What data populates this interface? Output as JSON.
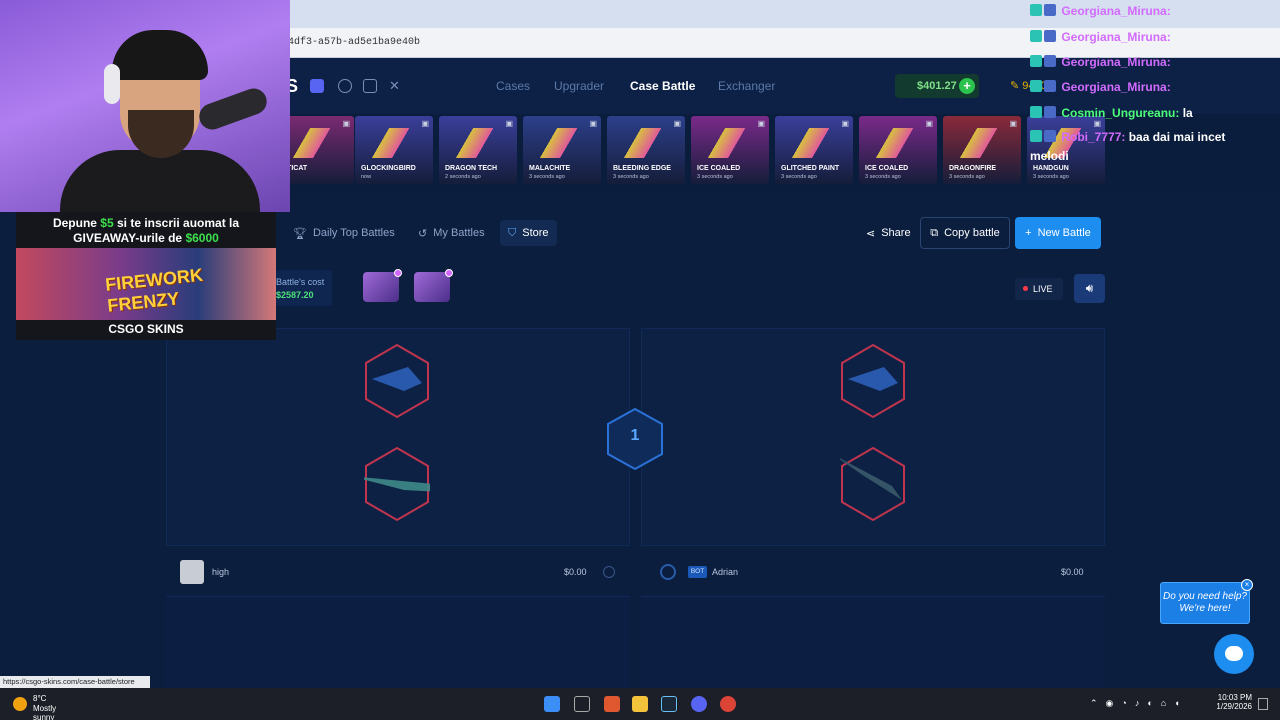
{
  "browser": {
    "url_fragment": "4df3-a57b-ad5e1ba9e40b",
    "status_url": "https://csgo-skins.com/case-battle/store"
  },
  "site": {
    "logo_letter": "S",
    "nav": [
      "Cases",
      "Upgrader",
      "Case Battle",
      "Exchanger"
    ],
    "active_nav": "Case Battle",
    "balance": "$401.27",
    "points": "9400",
    "accent": "#1e8df0"
  },
  "drops": [
    {
      "name": "CTICAT",
      "time": "",
      "color": "#7a2a72"
    },
    {
      "name": "GLOCKINGBIRD",
      "time": "now",
      "color": "#3a3f9a"
    },
    {
      "name": "DRAGON TECH",
      "time": "2 seconds ago",
      "color": "#3a3f9a"
    },
    {
      "name": "MALACHITE",
      "time": "3 seconds ago",
      "color": "#2c3f8a"
    },
    {
      "name": "BLEEDING EDGE",
      "time": "3 seconds ago",
      "color": "#2c3f8a"
    },
    {
      "name": "ICE COALED",
      "time": "3 seconds ago",
      "color": "#7a2a8a"
    },
    {
      "name": "GLITCHED PAINT",
      "time": "3 seconds ago",
      "color": "#3a3f9a"
    },
    {
      "name": "ICE COALED",
      "time": "3 seconds ago",
      "color": "#7a2a8a"
    },
    {
      "name": "DRAGONFIRE",
      "time": "3 seconds ago",
      "color": "#8a2a3a"
    },
    {
      "name": "HANDGUN",
      "time": "3 seconds ago",
      "color": "#3a3f9a"
    }
  ],
  "toolbar": {
    "daily_top": "Daily Top Battles",
    "my_battles": "My Battles",
    "store": "Store",
    "share": "Share",
    "copy": "Copy battle",
    "new_battle": "New Battle"
  },
  "battle": {
    "cost_label": "Battle's cost",
    "cost_value": "$2587.20",
    "live": "LIVE",
    "round": "1",
    "players": [
      {
        "name": "high",
        "total": "$0.00"
      },
      {
        "name": "Adrian",
        "total": "$0.00",
        "tag": "BOT"
      }
    ]
  },
  "help": {
    "line1": "Do you need help?",
    "line2": "We're here!"
  },
  "taskbar": {
    "temp": "8°C",
    "weather": "Mostly sunny",
    "time": "10:03 PM",
    "date": "1/29/2026"
  },
  "stream": {
    "promo_line1_a": "Depune ",
    "promo_line1_amount": "$5",
    "promo_line1_b": " si te inscrii auomat la",
    "promo_line2_a": "GIVEAWAY-urile de ",
    "promo_line2_amount": "$6000",
    "promo_art_title": "FIREWORK FRENZY",
    "promo_brand": "CSGO SKINS",
    "chat": [
      {
        "user": "Georgiana_Miruna:",
        "msg": "",
        "color": "#d36bff"
      },
      {
        "user": "Georgiana_Miruna:",
        "msg": "",
        "color": "#d36bff"
      },
      {
        "user": "Georgiana_Miruna:",
        "msg": "",
        "color": "#d36bff"
      },
      {
        "user": "Georgiana_Miruna:",
        "msg": "",
        "color": "#d36bff"
      },
      {
        "user": "Cosmin_Ungureanu:",
        "msg": "la",
        "color": "#4cff7a"
      },
      {
        "user": "Robi_7777:",
        "msg": "baa dai mai incet",
        "color": "#d36bff"
      },
      {
        "user": "",
        "msg": "melodi",
        "color": "#ffffff"
      }
    ]
  }
}
